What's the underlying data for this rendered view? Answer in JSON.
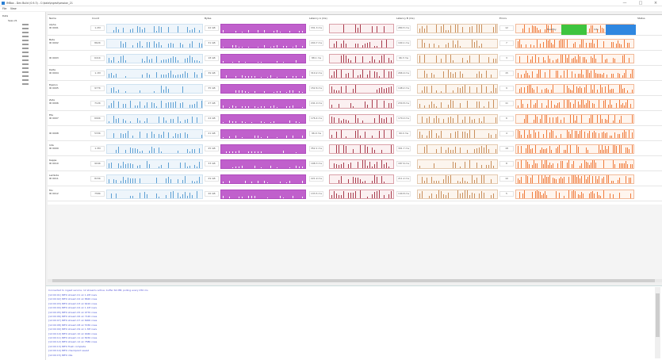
{
  "window": {
    "title": "IMBox - Dev Build (0.9.3) - C:\\data\\ingest\\session_21",
    "minimize": "—",
    "maximize": "□",
    "close": "×"
  },
  "menu": {
    "file": "File",
    "view": "View"
  },
  "tree": {
    "root": "Data",
    "child": "Sess 21",
    "node_count": 16
  },
  "grid": {
    "headers": {
      "name": "Name",
      "count": "Count",
      "bytes": "Bytes",
      "latency_a": "Latency A (ms)",
      "latency_b": "Latency B (ms)",
      "errors": "Errors",
      "status": "Status"
    },
    "legend": {
      "ok_label": "Healthy",
      "warn_label": "Info"
    },
    "rows": [
      {
        "name": "Alpha",
        "sub": "ID 0001",
        "count": "1.2M",
        "bytes": "42 GB",
        "lat_a": "331.3 ms",
        "lat_b": "280.5 ms",
        "err": "12"
      },
      {
        "name": "Beta",
        "sub": "ID 0002",
        "count": "862K",
        "bytes": "31 GB",
        "lat_a": "204.7 ms",
        "lat_b": "190.1 ms",
        "err": "7"
      },
      {
        "name": "",
        "sub": "ID 0003",
        "count": "641K",
        "bytes": "18 GB",
        "lat_a": "88.1 ms",
        "lat_b": "96.3 ms",
        "err": "3"
      },
      {
        "name": "Delta",
        "sub": "ID 0004",
        "count": "1.1M",
        "bytes": "39 GB",
        "lat_a": "310.2 ms",
        "lat_b": "266.9 ms",
        "err": "15"
      },
      {
        "name": "Epsilon",
        "sub": "ID 0005",
        "count": "977K",
        "bytes": "35 GB",
        "lat_a": "152.6 ms",
        "lat_b": "148.2 ms",
        "err": "9"
      },
      {
        "name": "Zeta",
        "sub": "ID 0006",
        "count": "712K",
        "bytes": "27 GB",
        "lat_a": "241.0 ms",
        "lat_b": "230.8 ms",
        "err": "11"
      },
      {
        "name": "Eta",
        "sub": "ID 0007",
        "count": "690K",
        "bytes": "24 GB",
        "lat_a": "176.4 ms",
        "lat_b": "170.0 ms",
        "err": "6"
      },
      {
        "name": "",
        "sub": "ID 0008",
        "count": "533K",
        "bytes": "21 GB",
        "lat_a": "96.9 ms",
        "lat_b": "99.4 ms",
        "err": "4"
      },
      {
        "name": "Iota",
        "sub": "ID 0009",
        "count": "1.3M",
        "bytes": "45 GB",
        "lat_a": "352.1 ms",
        "lat_b": "301.7 ms",
        "err": "18"
      },
      {
        "name": "Kappa",
        "sub": "ID 0010",
        "count": "904K",
        "bytes": "33 GB",
        "lat_a": "198.3 ms",
        "lat_b": "187.6 ms",
        "err": "8"
      },
      {
        "name": "Lambda",
        "sub": "ID 0011",
        "count": "815K",
        "bytes": "29 GB",
        "lat_a": "221.9 ms",
        "lat_b": "211.2 ms",
        "err": "10"
      },
      {
        "name": "Mu",
        "sub": "ID 0012",
        "count": "758K",
        "bytes": "26 GB",
        "lat_a": "133.5 ms",
        "lat_b": "140.8 ms",
        "err": "5"
      }
    ]
  },
  "log": {
    "header": "Connected to ingest service; 12 streams active; buffer 64 MB; polling every 250 ms",
    "lines": [
      "[12:00:01] INFO  stream 01 ok  1.2M rows",
      "[12:00:02] INFO  stream 02 ok  862K rows",
      "[12:00:03] INFO  stream 03 ok  641K rows",
      "[12:00:04] INFO  stream 04 ok  1.1M rows",
      "[12:00:05] INFO  stream 05 ok  977K rows",
      "[12:00:06] INFO  stream 06 ok  712K rows",
      "[12:00:07] INFO  stream 07 ok  690K rows",
      "[12:00:08] INFO  stream 08 ok  533K rows",
      "[12:00:09] INFO  stream 09 ok  1.3M rows",
      "[12:00:10] INFO  stream 10 ok  904K rows",
      "[12:00:11] INFO  stream 11 ok  815K rows",
      "[12:00:12] INFO  stream 12 ok  758K rows",
      "[12:00:13] INFO  flush complete",
      "[12:00:14] INFO  checkpoint saved",
      "[12:00:15] INFO  idle"
    ]
  }
}
